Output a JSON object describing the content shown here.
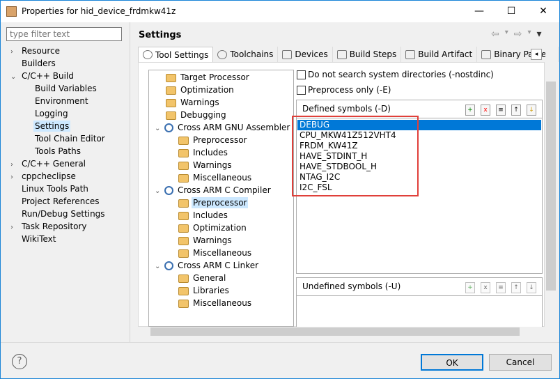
{
  "window": {
    "title": "Properties for hid_device_frdmkw41z",
    "minimize": "—",
    "maximize": "☐",
    "close": "✕"
  },
  "filter": {
    "placeholder": "type filter text"
  },
  "nav": [
    {
      "label": "Resource",
      "chev": "›",
      "level": 0
    },
    {
      "label": "Builders",
      "chev": "",
      "level": 0
    },
    {
      "label": "C/C++ Build",
      "chev": "⌄",
      "level": 0
    },
    {
      "label": "Build Variables",
      "chev": "",
      "level": 1
    },
    {
      "label": "Environment",
      "chev": "",
      "level": 1
    },
    {
      "label": "Logging",
      "chev": "",
      "level": 1
    },
    {
      "label": "Settings",
      "chev": "",
      "level": 1,
      "selected": true
    },
    {
      "label": "Tool Chain Editor",
      "chev": "",
      "level": 1
    },
    {
      "label": "Tools Paths",
      "chev": "",
      "level": 1
    },
    {
      "label": "C/C++ General",
      "chev": "›",
      "level": 0
    },
    {
      "label": "cppcheclipse",
      "chev": "›",
      "level": 0
    },
    {
      "label": "Linux Tools Path",
      "chev": "",
      "level": 0
    },
    {
      "label": "Project References",
      "chev": "",
      "level": 0
    },
    {
      "label": "Run/Debug Settings",
      "chev": "",
      "level": 0
    },
    {
      "label": "Task Repository",
      "chev": "›",
      "level": 0
    },
    {
      "label": "WikiText",
      "chev": "",
      "level": 0
    }
  ],
  "header": {
    "title": "Settings",
    "back": "⇦",
    "fwd": "⇨",
    "menu": "▾"
  },
  "tabs": [
    "Tool Settings",
    "Toolchains",
    "Devices",
    "Build Steps",
    "Build Artifact",
    "Binary Parsers"
  ],
  "tool_tree": [
    {
      "label": "Target Processor",
      "level": 1,
      "type": "folder"
    },
    {
      "label": "Optimization",
      "level": 1,
      "type": "folder"
    },
    {
      "label": "Warnings",
      "level": 1,
      "type": "folder"
    },
    {
      "label": "Debugging",
      "level": 1,
      "type": "folder"
    },
    {
      "label": "Cross ARM GNU Assembler",
      "level": 0,
      "type": "tool"
    },
    {
      "label": "Preprocessor",
      "level": 2,
      "type": "folder"
    },
    {
      "label": "Includes",
      "level": 2,
      "type": "folder"
    },
    {
      "label": "Warnings",
      "level": 2,
      "type": "folder"
    },
    {
      "label": "Miscellaneous",
      "level": 2,
      "type": "folder"
    },
    {
      "label": "Cross ARM C Compiler",
      "level": 0,
      "type": "tool"
    },
    {
      "label": "Preprocessor",
      "level": 2,
      "type": "folder",
      "selected": true
    },
    {
      "label": "Includes",
      "level": 2,
      "type": "folder"
    },
    {
      "label": "Optimization",
      "level": 2,
      "type": "folder"
    },
    {
      "label": "Warnings",
      "level": 2,
      "type": "folder"
    },
    {
      "label": "Miscellaneous",
      "level": 2,
      "type": "folder"
    },
    {
      "label": "Cross ARM C Linker",
      "level": 0,
      "type": "tool"
    },
    {
      "label": "General",
      "level": 2,
      "type": "folder"
    },
    {
      "label": "Libraries",
      "level": 2,
      "type": "folder"
    },
    {
      "label": "Miscellaneous",
      "level": 2,
      "type": "folder"
    }
  ],
  "options": {
    "nostdinc": "Do not search system directories (-nostdinc)",
    "preprocess_only": "Preprocess only (-E)"
  },
  "defined": {
    "title": "Defined symbols (-D)",
    "symbols": [
      "DEBUG",
      "CPU_MKW41Z512VHT4",
      "FRDM_KW41Z",
      "HAVE_STDINT_H",
      "HAVE_STDBOOL_H",
      "NTAG_I2C",
      "I2C_FSL"
    ]
  },
  "undefined": {
    "title": "Undefined symbols (-U)"
  },
  "buttons": {
    "help": "?",
    "ok": "OK",
    "cancel": "Cancel"
  }
}
